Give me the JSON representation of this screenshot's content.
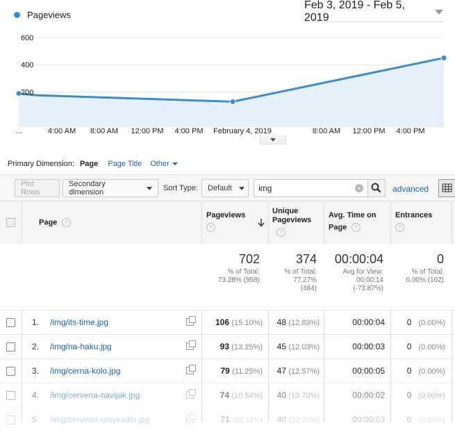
{
  "header": {
    "legend_label": "Pageviews",
    "legend_color": "#3b8bd0",
    "date_range": "Feb 3, 2019 - Feb 5, 2019"
  },
  "chart_data": {
    "type": "area",
    "series": [
      {
        "name": "Pageviews",
        "values": [
          190,
          177,
          130,
          450
        ]
      }
    ],
    "x": [
      "Feb 3, 2019",
      "Feb 4, 2019 00:00",
      "Feb 4, 2019 (later)",
      "Feb 5, 2019"
    ],
    "ylim": [
      0,
      650
    ],
    "yticks": [
      "600",
      "400",
      "200"
    ],
    "xticks": [
      "...",
      "4:00 AM",
      "8:00 AM",
      "12:00 PM",
      "4:00 PM",
      "February 4, 2019",
      "8:00 AM",
      "12:00 PM",
      "4:00 PM"
    ],
    "grid": true,
    "color": "#3b8bd0"
  },
  "primary_dimension": {
    "label": "Primary Dimension:",
    "selected": "Page",
    "option_page_title": "Page Title",
    "option_other": "Other"
  },
  "toolbar": {
    "plot_rows": "Plot Rows",
    "secondary_dimension": "Secondary dimension",
    "sort_type_label": "Sort Type:",
    "sort_type_value": "Default",
    "search_value": "img",
    "advanced": "advanced"
  },
  "table": {
    "headers": {
      "page": "Page",
      "pageviews": "Pageviews",
      "unique_pageviews_1": "Unique",
      "unique_pageviews_2": "Pageviews",
      "avg_time_1": "Avg. Time on",
      "avg_time_2": "Page",
      "entrances": "Entrances"
    },
    "totals": {
      "pageviews": "702",
      "pageviews_sub1": "% of Total:",
      "pageviews_sub2": "73.28% (958)",
      "unique": "374",
      "unique_sub1": "% of Total:",
      "unique_sub2": "77.27%",
      "unique_sub3": "(484)",
      "avg_time": "00:00:04",
      "avg_time_sub1": "Avg for View:",
      "avg_time_sub2": "00:00:14",
      "avg_time_sub3": "(-73.87%)",
      "entrances": "0",
      "entrances_sub1": "% of Total:",
      "entrances_sub2": "0.00% (102)"
    },
    "rows": [
      {
        "num": "1.",
        "page": "/img/its-time.jpg",
        "pv": "106",
        "pv_pct": "(15.10%)",
        "upv": "48",
        "upv_pct": "(12.83%)",
        "avg": "00:00:04",
        "ent": "0",
        "ent_pct": "(0.00%)"
      },
      {
        "num": "2.",
        "page": "/img/na-haku.jpg",
        "pv": "93",
        "pv_pct": "(13.25%)",
        "upv": "45",
        "upv_pct": "(12.03%)",
        "avg": "00:00:03",
        "ent": "0",
        "ent_pct": "(0.00%)"
      },
      {
        "num": "3.",
        "page": "/img/cerna-kolo.jpg",
        "pv": "79",
        "pv_pct": "(11.25%)",
        "upv": "47",
        "upv_pct": "(12.57%)",
        "avg": "00:00:05",
        "ent": "0",
        "ent_pct": "(0.00%)"
      },
      {
        "num": "4.",
        "page": "/img/cervena-navijak.jpg",
        "pv": "74",
        "pv_pct": "(10.54%)",
        "upv": "40",
        "upv_pct": "(10.70%)",
        "avg": "00:00:02",
        "ent": "0",
        "ent_pct": "(0.00%)"
      },
      {
        "num": "5.",
        "page": "/img/cervena-umyvadlo.jpg",
        "pv": "71",
        "pv_pct": "(10.11%)",
        "upv": "40",
        "upv_pct": "(10.70%)",
        "avg": "00:00:03",
        "ent": "0",
        "ent_pct": "(0.00%)"
      }
    ]
  }
}
